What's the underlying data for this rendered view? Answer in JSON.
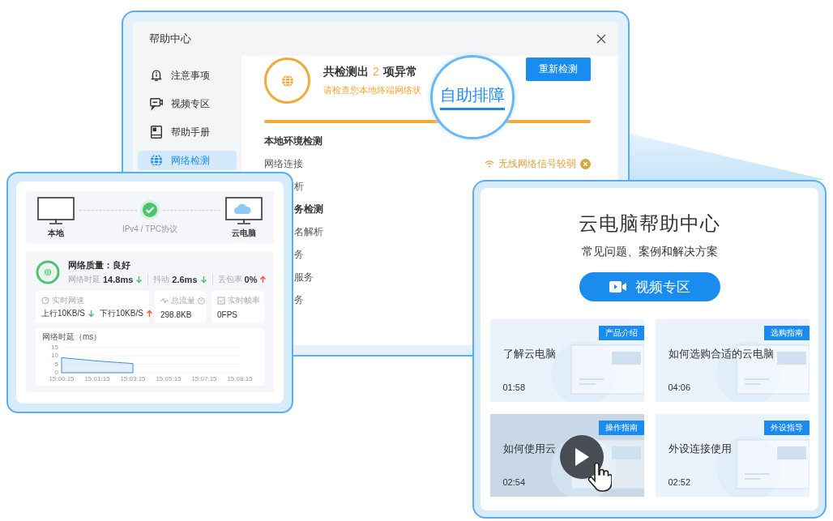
{
  "help_window": {
    "title": "帮助中心",
    "sidebar": [
      {
        "kind": "bell",
        "label": "注意事项",
        "selected": false
      },
      {
        "kind": "chat",
        "label": "视频专区",
        "selected": false
      },
      {
        "kind": "book",
        "label": "帮助手册",
        "selected": false
      },
      {
        "kind": "globe",
        "label": "网络检测",
        "selected": true
      }
    ],
    "summary": {
      "prefix": "共检测出",
      "count": "2",
      "suffix": "项异常",
      "hint": "请检查您本地终端网络状",
      "level": 1
    },
    "recheck_button": "重新检测",
    "rows": [
      {
        "kind": "heading",
        "label": "本地环境检测"
      },
      {
        "kind": "item",
        "label": "网络连接",
        "status": "无线网络信号较弱"
      }
    ],
    "cut_rows": [
      {
        "kind": "item",
        "label": "析"
      },
      {
        "kind": "heading",
        "label": "务检测"
      },
      {
        "kind": "item",
        "label": "名解析"
      },
      {
        "kind": "item",
        "label": "务"
      },
      {
        "kind": "item",
        "label": "服务"
      },
      {
        "kind": "item",
        "label": "务"
      }
    ]
  },
  "lens": {
    "label": "自助排障"
  },
  "network_panel": {
    "local_label": "本地",
    "protocol": "IPv4 / TPC协议",
    "cloud_label": "云电脑",
    "quality": "网络质量：良好",
    "metrics": [
      {
        "label": "网络时延",
        "value": "14.8ms",
        "rising": false
      },
      {
        "label": "抖动",
        "value": "2.6ms",
        "rising": false
      },
      {
        "label": "丢包率",
        "value": "0%",
        "rising": true
      }
    ],
    "stats": [
      {
        "kind": "speed",
        "label": "实时网速",
        "values": [
          {
            "value": "上行10KB/S",
            "rising": false
          },
          {
            "value": "下行10KB/S",
            "rising": true
          }
        ]
      },
      {
        "kind": "traffic",
        "label": "总流量",
        "values": [
          {
            "value": "298.8KB"
          }
        ]
      },
      {
        "kind": "fps",
        "label": "实时帧率",
        "values": [
          {
            "value": "0FPS"
          }
        ]
      }
    ],
    "chart_data": {
      "type": "area",
      "title": "网络时延（ms）",
      "categories": [
        "15:00:15",
        "15:01:15",
        "15:03:15",
        "15:05:15",
        "15:07:15",
        "15:08:15"
      ],
      "series": [
        {
          "color": "#3d8fd8",
          "values": [
            9,
            7,
            5.5,
            null,
            null,
            null
          ]
        }
      ],
      "ylim": [
        0,
        15
      ],
      "yticks": [
        0,
        5,
        10,
        15
      ]
    }
  },
  "video_center": {
    "title": "云电脑帮助中心",
    "subtitle": "常见问题、案例和解决方案",
    "button": "视频专区",
    "videos": [
      {
        "tag": "产品介绍",
        "title": "了解云电脑",
        "duration": "01:58",
        "selected": false
      },
      {
        "tag": "选购指南",
        "title": "如何选购合适的云电脑",
        "duration": "04:06",
        "selected": false
      },
      {
        "tag": "操作指南",
        "title": "如何使用云",
        "duration": "02:54",
        "selected": true
      },
      {
        "tag": "外设指导",
        "title": "外设连接使用",
        "duration": "02:52",
        "selected": false
      }
    ]
  }
}
